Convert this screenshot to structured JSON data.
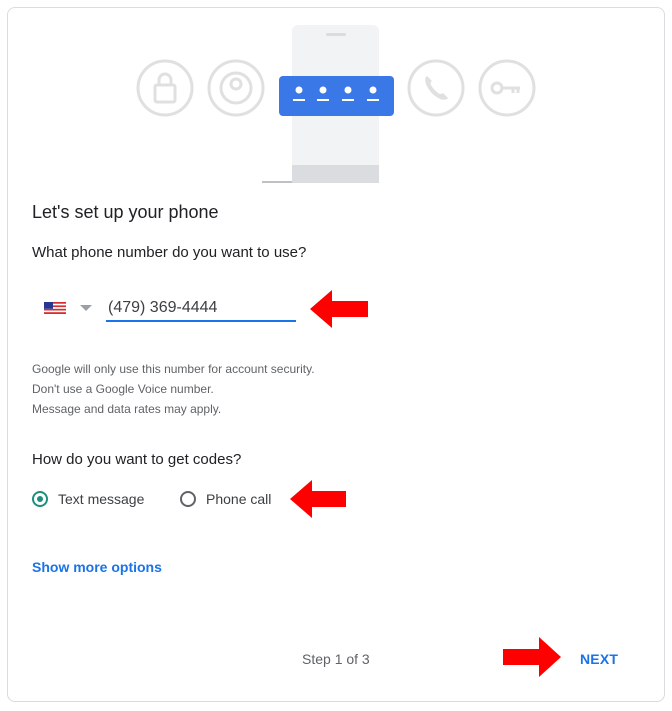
{
  "hero": {
    "icons": [
      "lock-icon",
      "account-icon",
      "pin-dots-icon",
      "phone-icon",
      "key-icon"
    ]
  },
  "setup": {
    "title": "Let's set up your phone",
    "phone_question": "What phone number do you want to use?",
    "country": "US",
    "phone_value": "(479) 369-4444",
    "notes": [
      "Google will only use this number for account security.",
      "Don't use a Google Voice number.",
      "Message and data rates may apply."
    ],
    "codes_question": "How do you want to get codes?",
    "options": [
      {
        "label": "Text message",
        "selected": true
      },
      {
        "label": "Phone call",
        "selected": false
      }
    ],
    "more_options": "Show more options"
  },
  "footer": {
    "step": "Step 1 of 3",
    "next": "NEXT"
  },
  "colors": {
    "accent": "#1a73e8",
    "radio_selected": "#1e8e7e",
    "annotation_arrow": "#ff0000"
  }
}
